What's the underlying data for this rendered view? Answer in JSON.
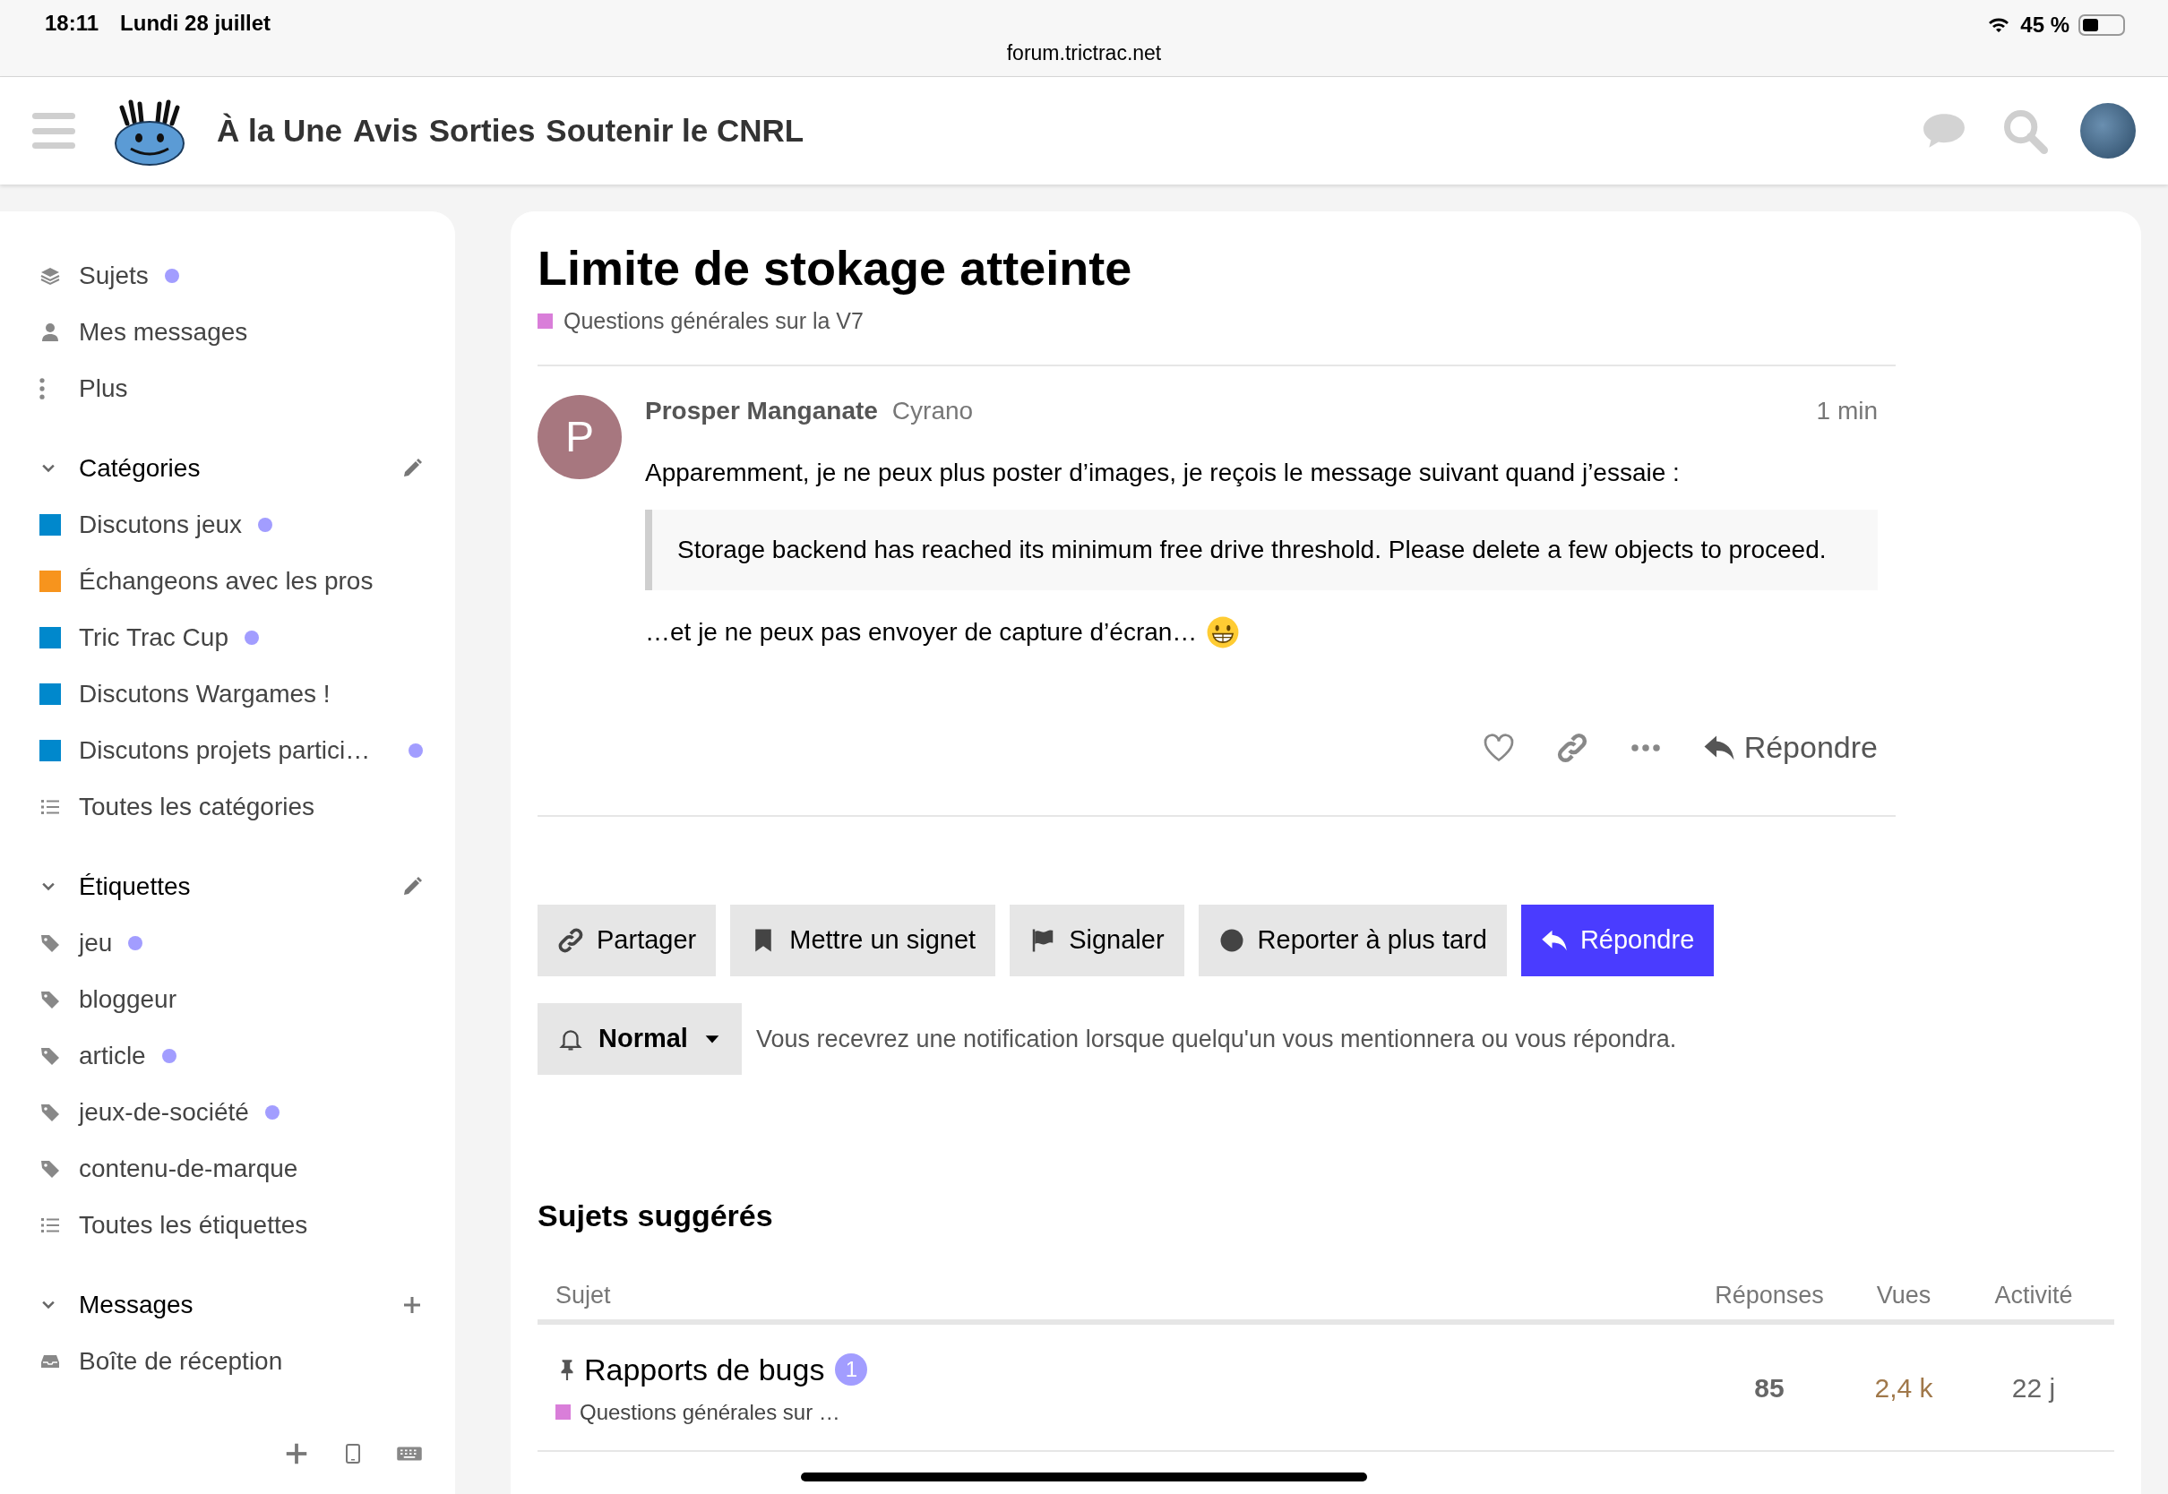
{
  "status_bar": {
    "time": "18:11",
    "date": "Lundi 28 juillet",
    "url": "forum.trictrac.net",
    "battery": "45 %"
  },
  "header": {
    "nav_links": [
      "À la Une",
      "Avis",
      "Sorties",
      "Soutenir le CNRL"
    ]
  },
  "sidebar": {
    "top_items": [
      {
        "kind": "topics",
        "label": "Sujets",
        "unread": true
      },
      {
        "kind": "user",
        "label": "Mes messages",
        "unread": false
      },
      {
        "kind": "more",
        "label": "Plus",
        "unread": false
      }
    ],
    "sections": [
      {
        "title": "Catégories",
        "expanded": true,
        "kind": "edit",
        "items": [
          {
            "kind": "category",
            "label": "Discutons jeux",
            "color": "#0088cc",
            "unread": true
          },
          {
            "kind": "category",
            "label": "Échangeons avec les pros",
            "color": "#f7941d",
            "unread": false
          },
          {
            "kind": "category",
            "label": "Tric Trac Cup",
            "color": "#0088cc",
            "unread": true
          },
          {
            "kind": "category",
            "label": "Discutons Wargames !",
            "color": "#0088cc",
            "unread": false
          },
          {
            "kind": "category",
            "label": "Discutons projets partici…",
            "color": "#0088cc",
            "unread": true
          },
          {
            "kind": "list",
            "label": "Toutes les catégories",
            "unread": false
          }
        ]
      },
      {
        "title": "Étiquettes",
        "expanded": true,
        "kind": "edit",
        "items": [
          {
            "kind": "tag",
            "label": "jeu",
            "unread": true
          },
          {
            "kind": "tag",
            "label": "bloggeur",
            "unread": false
          },
          {
            "kind": "tag",
            "label": "article",
            "unread": true
          },
          {
            "kind": "tag",
            "label": "jeux-de-société",
            "unread": true
          },
          {
            "kind": "tag",
            "label": "contenu-de-marque",
            "unread": false
          },
          {
            "kind": "list",
            "label": "Toutes les étiquettes",
            "unread": false
          }
        ]
      },
      {
        "title": "Messages",
        "expanded": true,
        "kind": "add",
        "items": [
          {
            "kind": "inbox",
            "label": "Boîte de réception",
            "unread": false
          }
        ]
      }
    ]
  },
  "topic": {
    "title": "Limite de stokage atteinte",
    "category": {
      "name": "Questions générales sur la V7",
      "color": "#d97ed9"
    },
    "post": {
      "avatar_letter": "P",
      "author": "Prosper Manganate",
      "username": "Cyrano",
      "time": "1 min",
      "paragraph": "Apparemment, je ne peux plus poster d’images, je reçois le message suivant quand j’essaie :",
      "quote": "Storage backend has reached its minimum free drive threshold. Please delete a few objects to proceed.",
      "last_paragraph": "…et je ne peux pas envoyer de capture d’écran…",
      "reply_label": "Répondre"
    },
    "buttons": [
      {
        "kind": "share",
        "label": "Partager"
      },
      {
        "kind": "bookmark",
        "label": "Mettre un signet"
      },
      {
        "kind": "flag",
        "label": "Signaler"
      },
      {
        "kind": "later",
        "label": "Reporter à plus tard"
      },
      {
        "kind": "reply",
        "label": "Répondre"
      }
    ],
    "notification": {
      "level": "Normal",
      "description": "Vous recevrez une notification lorsque quelqu'un vous mentionnera ou vous répondra."
    }
  },
  "suggested": {
    "heading": "Sujets suggérés",
    "columns": [
      "Sujet",
      "Réponses",
      "Vues",
      "Activité"
    ],
    "rows": [
      {
        "title": "Rapports de bugs",
        "pinned": true,
        "badge": "1",
        "category": {
          "name": "Questions générales sur …",
          "color": "#d97ed9"
        },
        "replies": "85",
        "views": "2,4 k",
        "activity": "22 j"
      }
    ]
  }
}
